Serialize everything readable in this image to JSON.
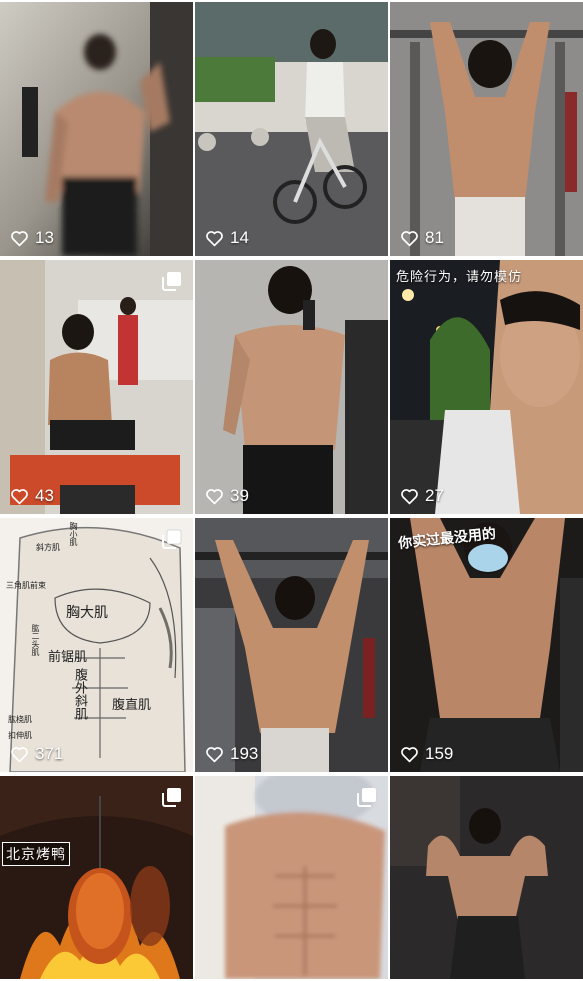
{
  "grid": {
    "tiles": [
      {
        "likes": "13",
        "multi": false,
        "overlay": ""
      },
      {
        "likes": "14",
        "multi": false,
        "overlay": ""
      },
      {
        "likes": "81",
        "multi": false,
        "overlay": ""
      },
      {
        "likes": "43",
        "multi": true,
        "overlay": ""
      },
      {
        "likes": "39",
        "multi": false,
        "overlay": ""
      },
      {
        "likes": "27",
        "multi": false,
        "overlay": "危险行为，请勿模仿"
      },
      {
        "likes": "371",
        "multi": true,
        "overlay": ""
      },
      {
        "likes": "193",
        "multi": false,
        "overlay": ""
      },
      {
        "likes": "159",
        "multi": false,
        "overlay": "你实过最没用的"
      },
      {
        "likes": "",
        "multi": true,
        "overlay": "北京烤鸭"
      },
      {
        "likes": "",
        "multi": true,
        "overlay": ""
      },
      {
        "likes": "",
        "multi": false,
        "overlay": ""
      }
    ]
  },
  "anatomy_labels": {
    "chest": "胸大肌",
    "serratus": "前锯肌",
    "oblique": "腹外斜肌",
    "abs": "腹直肌",
    "deltoid": "三角肌前束",
    "lat": "肱二头肌",
    "tiny1": "斜方肌",
    "tiny2": "胸小肌",
    "tiny3": "肱桡肌",
    "tiny4": "肱二头肌",
    "tiny5": "扣伸肌"
  },
  "icons": {
    "heart": "heart-outline-icon",
    "multi": "multi-image-icon"
  },
  "colors": {
    "text": "#ffffff",
    "background": "#ffffff"
  }
}
